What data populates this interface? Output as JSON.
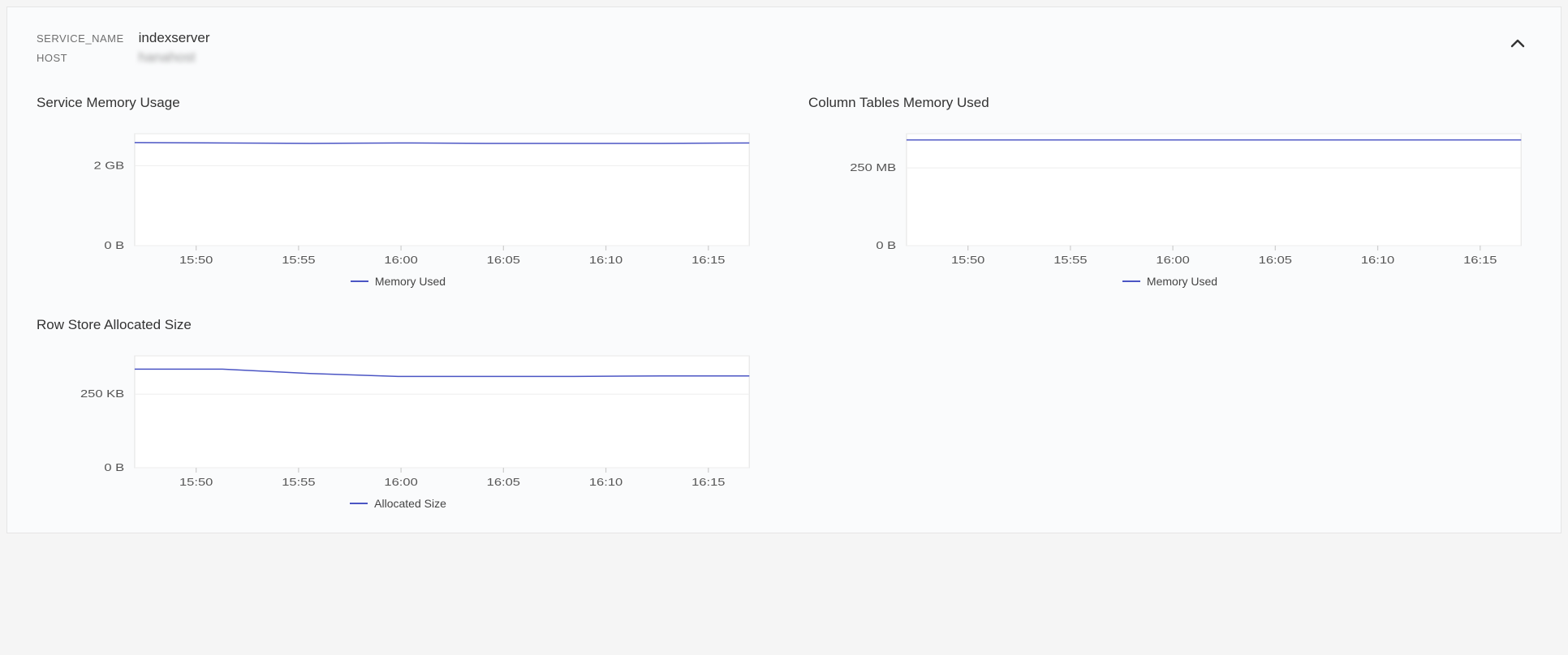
{
  "meta": {
    "service_name_label": "SERVICE_NAME",
    "service_name_value": "indexserver",
    "host_label": "HOST",
    "host_value": "hanahost"
  },
  "colors": {
    "series": "#4b55c4"
  },
  "chart_data": [
    {
      "id": "service-memory-usage",
      "type": "line",
      "title": "Service Memory Usage",
      "x": [
        "15:50",
        "15:55",
        "16:00",
        "16:05",
        "16:10",
        "16:15"
      ],
      "y_ticks": [
        {
          "v": 0,
          "label": "0 B"
        },
        {
          "v": 2,
          "label": "2 GB"
        }
      ],
      "ylim": [
        0,
        2.8
      ],
      "series": [
        {
          "name": "Memory Used",
          "values": [
            2.58,
            2.57,
            2.56,
            2.57,
            2.56,
            2.56,
            2.56,
            2.57
          ]
        }
      ]
    },
    {
      "id": "column-tables-memory-used",
      "type": "line",
      "title": "Column Tables Memory Used",
      "x": [
        "15:50",
        "15:55",
        "16:00",
        "16:05",
        "16:10",
        "16:15"
      ],
      "y_ticks": [
        {
          "v": 0,
          "label": "0 B"
        },
        {
          "v": 250,
          "label": "250 MB"
        }
      ],
      "ylim": [
        0,
        360
      ],
      "series": [
        {
          "name": "Memory Used",
          "values": [
            340,
            340,
            340,
            340,
            340,
            340,
            340,
            340
          ]
        }
      ]
    },
    {
      "id": "row-store-allocated-size",
      "type": "line",
      "title": "Row Store Allocated Size",
      "x": [
        "15:50",
        "15:55",
        "16:00",
        "16:05",
        "16:10",
        "16:15"
      ],
      "y_ticks": [
        {
          "v": 0,
          "label": "0 B"
        },
        {
          "v": 250,
          "label": "250 KB"
        }
      ],
      "ylim": [
        0,
        380
      ],
      "series": [
        {
          "name": "Allocated Size",
          "values": [
            335,
            335,
            320,
            310,
            310,
            310,
            312,
            312
          ]
        }
      ]
    }
  ]
}
